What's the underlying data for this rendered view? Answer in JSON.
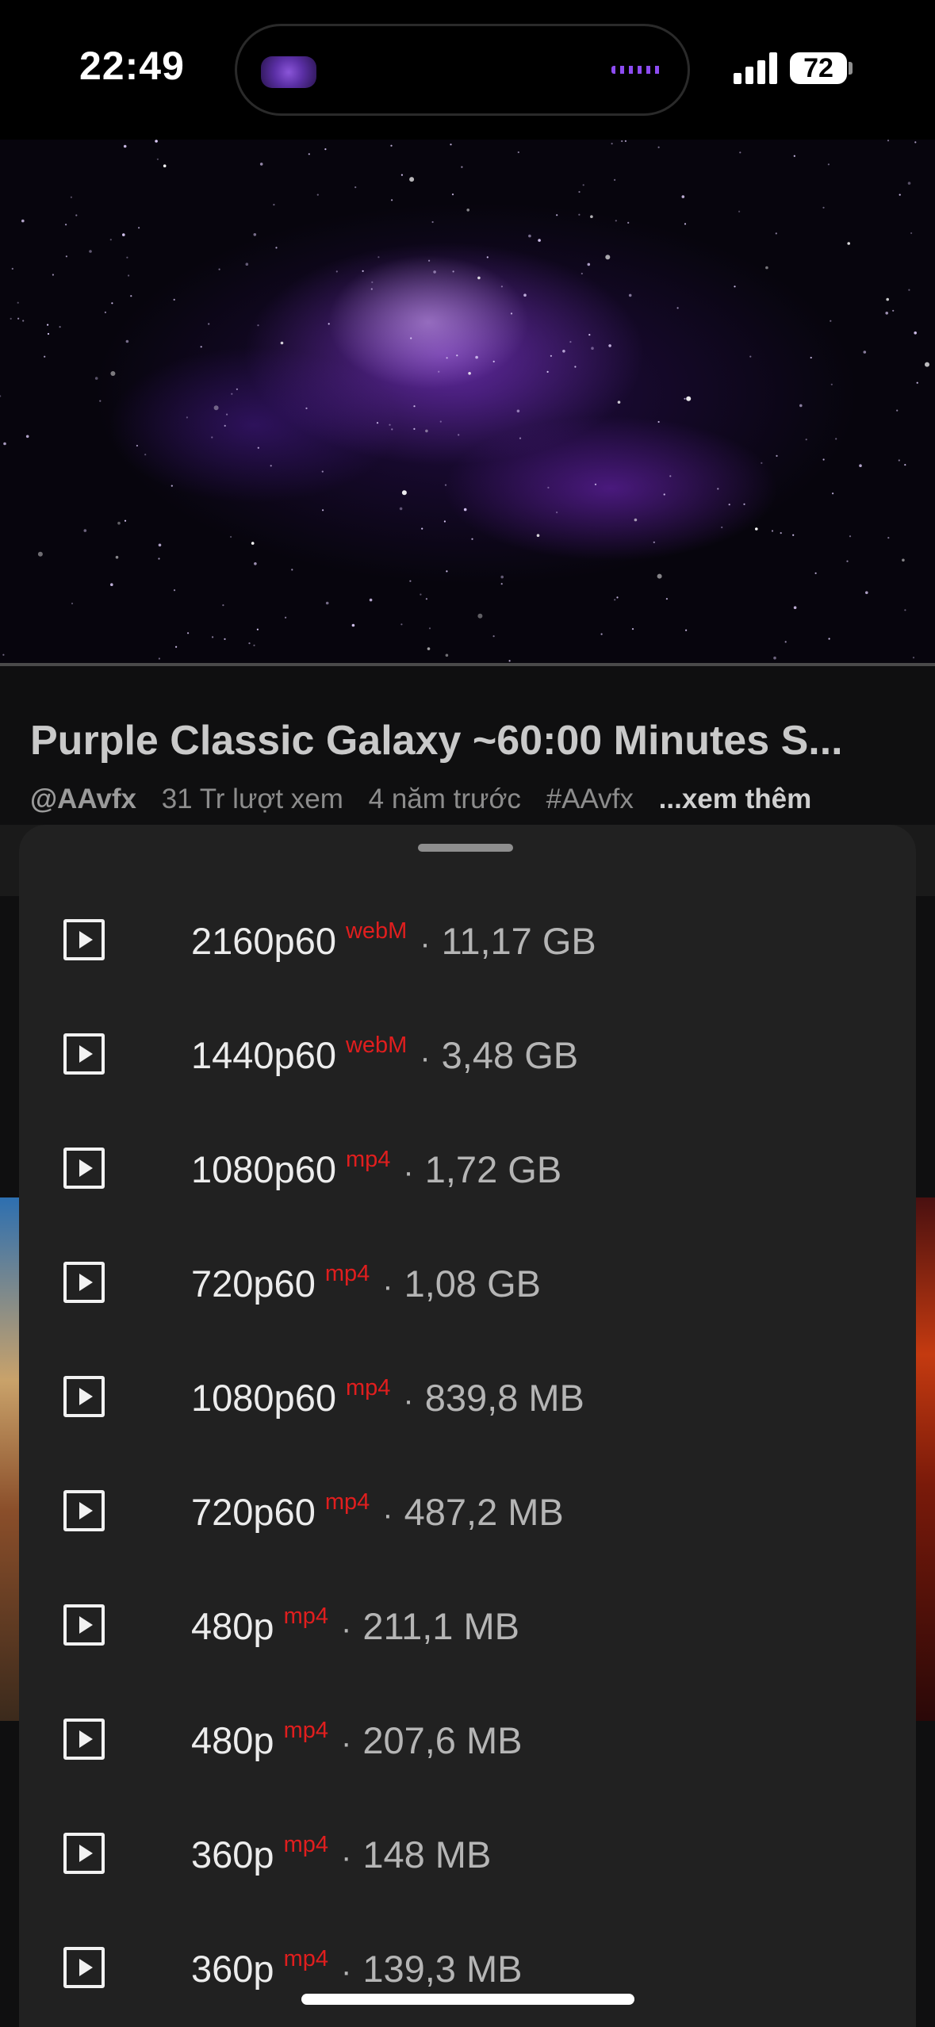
{
  "status_bar": {
    "time": "22:49",
    "battery": "72"
  },
  "video": {
    "title": "Purple Classic Galaxy ~60:00 Minutes S...",
    "channel": "@AAvfx",
    "views": "31 Tr lượt xem",
    "age": "4 năm trước",
    "hashtag": "#AAvfx",
    "more": "...xem thêm"
  },
  "download_options": [
    {
      "resolution": "2160p60",
      "format": "webM",
      "size": "11,17 GB"
    },
    {
      "resolution": "1440p60",
      "format": "webM",
      "size": "3,48 GB"
    },
    {
      "resolution": "1080p60",
      "format": "mp4",
      "size": "1,72 GB"
    },
    {
      "resolution": "720p60",
      "format": "mp4",
      "size": "1,08 GB"
    },
    {
      "resolution": "1080p60",
      "format": "mp4",
      "size": "839,8 MB"
    },
    {
      "resolution": "720p60",
      "format": "mp4",
      "size": "487,2 MB"
    },
    {
      "resolution": "480p",
      "format": "mp4",
      "size": "211,1 MB"
    },
    {
      "resolution": "480p",
      "format": "mp4",
      "size": "207,6 MB"
    },
    {
      "resolution": "360p",
      "format": "mp4",
      "size": "148 MB"
    },
    {
      "resolution": "360p",
      "format": "mp4",
      "size": "139,3 MB"
    }
  ],
  "separator": "·",
  "icons": {
    "option": "play-icon",
    "signal": "cellular-signal-icon",
    "battery": "battery-icon"
  },
  "colors": {
    "format_tag": "#e01e1e",
    "sheet_bg": "#212121",
    "accent_purple": "#8d4cf2"
  }
}
